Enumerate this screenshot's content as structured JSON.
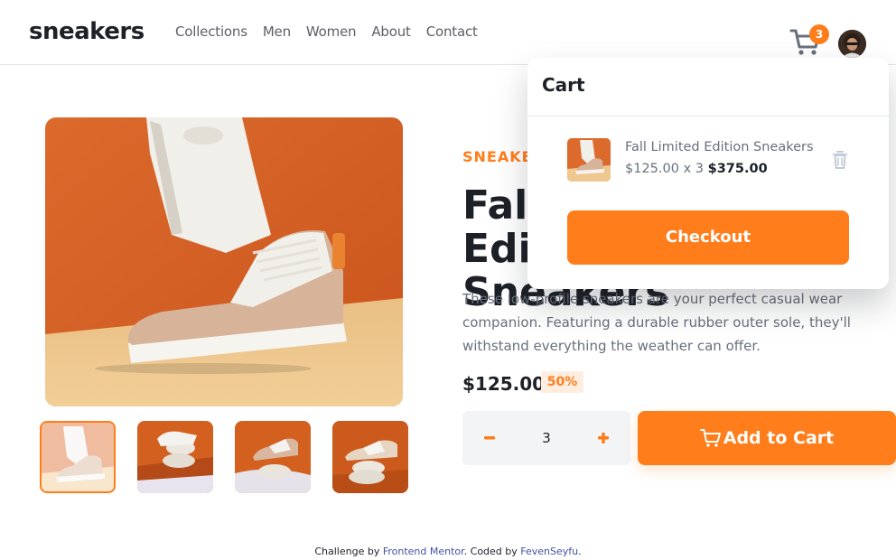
{
  "brand": {
    "logo": "sneakers"
  },
  "nav": {
    "items": [
      "Collections",
      "Men",
      "Women",
      "About",
      "Contact"
    ]
  },
  "header": {
    "cart_count": "3",
    "avatar_icon": "user-avatar"
  },
  "colors": {
    "accent": "#ff7d1a",
    "accent_pale": "#ffede0",
    "dark": "#1d2026",
    "grey": "#68707d"
  },
  "product": {
    "company": "SNEAKER COMPANY",
    "title": "Fall Limited Edition Sneakers",
    "description": "These low-profile sneakers are your perfect casual wear companion. Featuring a durable rubber outer sole, they'll withstand everything the weather can offer.",
    "price": "$125.00",
    "discount": "50%"
  },
  "quantity": {
    "minus": "−",
    "value": "3",
    "plus": "+"
  },
  "add_to_cart": {
    "label": "Add to Cart",
    "icon": "cart-icon"
  },
  "cart": {
    "heading": "Cart",
    "item": {
      "name": "Fall Limited Edition Sneakers",
      "unit_price": "$125.00 x 3",
      "total": "$375.00"
    },
    "delete_icon": "trash-icon",
    "checkout_label": "Checkout"
  },
  "footer": {
    "prefix": "Challenge by",
    "link1": "Frontend Mentor",
    "middle": ". Coded by",
    "link2": "FevenSeyfu",
    "suffix": "."
  }
}
